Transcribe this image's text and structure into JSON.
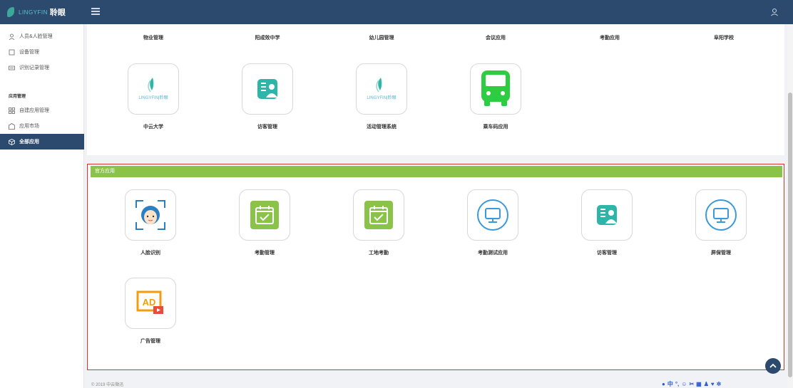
{
  "brand": {
    "logo_text": "LINGYFIN",
    "logo_cn": "聆眼"
  },
  "sidebar": {
    "items": [
      {
        "label": "人员&人脸管理"
      },
      {
        "label": "设备管理"
      },
      {
        "label": "识别记录管理"
      }
    ],
    "section_title": "应用管理",
    "app_items": [
      {
        "label": "自建应用管理"
      },
      {
        "label": "应用市场"
      },
      {
        "label": "全部应用"
      }
    ]
  },
  "top_row_labels": [
    "物业管理",
    "阳成效中学",
    "幼儿园管理",
    "会议应用",
    "考勤应用",
    "阜阳学校"
  ],
  "top_apps": [
    {
      "name": "中云大学",
      "icon": "lingyfin-logo"
    },
    {
      "name": "访客管理",
      "icon": "visitor-icon"
    },
    {
      "name": "活动管理系统",
      "icon": "lingyfin-logo"
    },
    {
      "name": "乘车码应用",
      "icon": "bus-icon"
    }
  ],
  "official": {
    "header": "官方应用",
    "apps": [
      {
        "name": "人脸识别",
        "icon": "face-recognition-icon"
      },
      {
        "name": "考勤管理",
        "icon": "calendar-check-icon"
      },
      {
        "name": "工地考勤",
        "icon": "calendar-check-icon"
      },
      {
        "name": "考勤测试应用",
        "icon": "monitor-icon"
      },
      {
        "name": "访客管理",
        "icon": "visitor-icon"
      },
      {
        "name": "屏保管理",
        "icon": "monitor-icon"
      },
      {
        "name": "广告管理",
        "icon": "ad-icon"
      }
    ]
  },
  "footer": {
    "text": "© 2019 中云微迅"
  },
  "ime": {
    "lang": "中"
  },
  "colors": {
    "nav": "#2c4a6e",
    "official_green": "#8bc34a",
    "bus_green": "#2ecc40",
    "accent_teal": "#2cb5a8",
    "monitor_blue": "#3a9ad9",
    "highlight_red": "#e0302c"
  }
}
